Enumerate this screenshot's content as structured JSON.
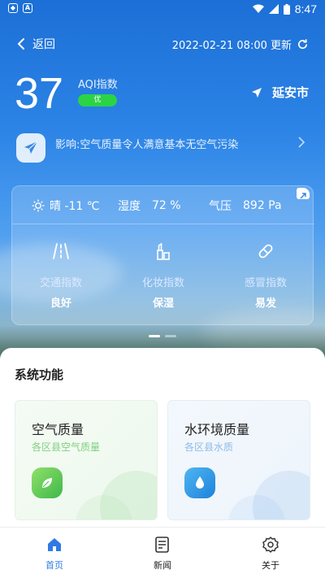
{
  "statusbar": {
    "time": "8:47"
  },
  "header": {
    "back_label": "返回",
    "update_text": "2022-02-21 08:00 更新"
  },
  "aqi": {
    "value": "37",
    "label": "AQI指数",
    "level": "优",
    "level_color": "#2bd445"
  },
  "location": {
    "city": "延安市"
  },
  "impact": {
    "text": "影响:空气质量令人满意基本无空气污染"
  },
  "weather": {
    "condition": "晴 -11 ℃",
    "humidity_label": "湿度",
    "humidity_value": "72 %",
    "pressure_label": "气压",
    "pressure_value": "892 Pa"
  },
  "indices": [
    {
      "name": "交通指数",
      "value": "良好",
      "icon": "road-icon"
    },
    {
      "name": "化妆指数",
      "value": "保湿",
      "icon": "cosmetics-icon"
    },
    {
      "name": "感冒指数",
      "value": "易发",
      "icon": "pill-icon"
    }
  ],
  "system": {
    "title": "系统功能",
    "cards": [
      {
        "title": "空气质量",
        "subtitle": "各区县空气质量",
        "icon": "leaf-icon",
        "accent": "#5fcf4f"
      },
      {
        "title": "水环境质量",
        "subtitle": "各区县水质",
        "icon": "water-drop-icon",
        "accent": "#2f9be8"
      }
    ]
  },
  "nav": [
    {
      "label": "首页",
      "icon": "home-icon",
      "active": true
    },
    {
      "label": "新闻",
      "icon": "news-icon",
      "active": false
    },
    {
      "label": "关于",
      "icon": "settings-icon",
      "active": false
    }
  ],
  "colors": {
    "primary": "#2f7be5"
  }
}
